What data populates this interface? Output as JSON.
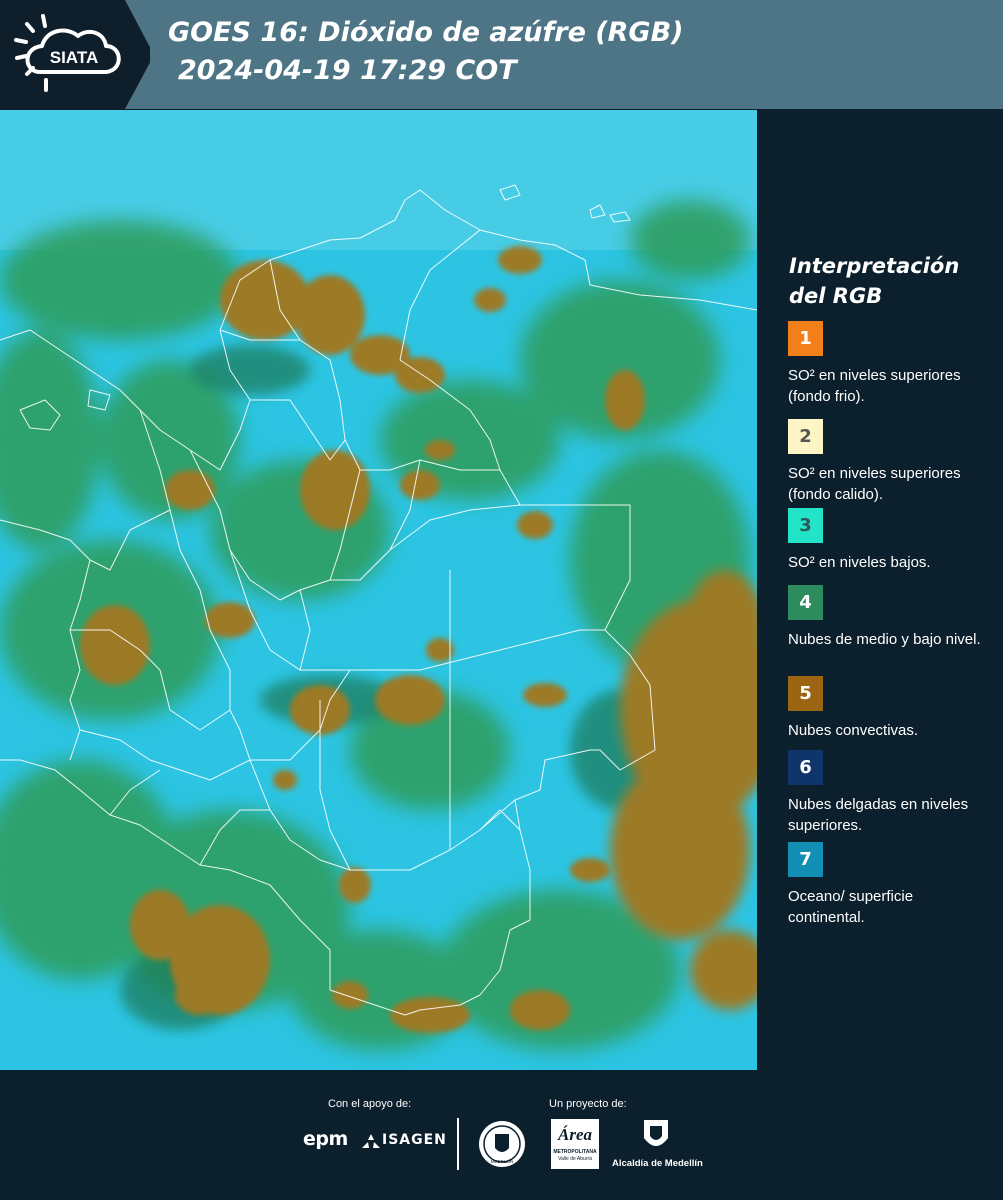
{
  "header": {
    "logo_text": "SIATA",
    "title_line1": "GOES 16: Dióxido de azúfre (RGB)",
    "title_line2": "2024-04-19 17:29 COT",
    "background": "#4d7585"
  },
  "map": {
    "content": "satellite RGB composite with department boundary outlines",
    "colors": {
      "cyan_background": "#29c6e3",
      "green_cloud": "#2e9c5a",
      "brown_convective": "#9a7a2a",
      "boundary_line": "#ffffff"
    }
  },
  "legend": {
    "title": "Interpretación del RGB",
    "items": [
      {
        "number": "1",
        "text": "SO² en niveles superiores (fondo frio).",
        "color": "#f37f1a",
        "number_color": "#ffffff"
      },
      {
        "number": "2",
        "text": "SO² en niveles superiores (fondo calido).",
        "color": "#fdf5c5",
        "number_color": "#555555"
      },
      {
        "number": "3",
        "text": "SO² en niveles bajos.",
        "color": "#23e3c8",
        "number_color": "#2b5a57"
      },
      {
        "number": "4",
        "text": "Nubes de medio y bajo nivel.",
        "color": "#2e8b5e",
        "number_color": "#ffffff"
      },
      {
        "number": "5",
        "text": "Nubes convectivas.",
        "color": "#9c6512",
        "number_color": "#ffffff"
      },
      {
        "number": "6",
        "text": "Nubes delgadas en niveles superiores.",
        "color": "#10356a",
        "number_color": "#ffffff"
      },
      {
        "number": "7",
        "text": "Oceano/ superficie continental.",
        "color": "#128fb4",
        "number_color": "#ffffff"
      }
    ]
  },
  "footer": {
    "support_label": "Con el apoyo de:",
    "project_label": "Un proyecto de:",
    "sponsors": [
      "epm",
      "ISAGEN"
    ],
    "partners": [
      "Universidad de Medellín",
      "Área Metropolitana Valle de Aburrá",
      "Alcaldía de Medellín"
    ],
    "epm_text": "epm",
    "isagen_text": "ISAGEN",
    "area_main": "Área",
    "area_sub1": "METROPOLITANA",
    "area_sub2": "Valle de Aburrá",
    "alcaldia_text": "Alcaldía de Medellín",
    "medellin_seal_text": "MEDELLÍN"
  }
}
